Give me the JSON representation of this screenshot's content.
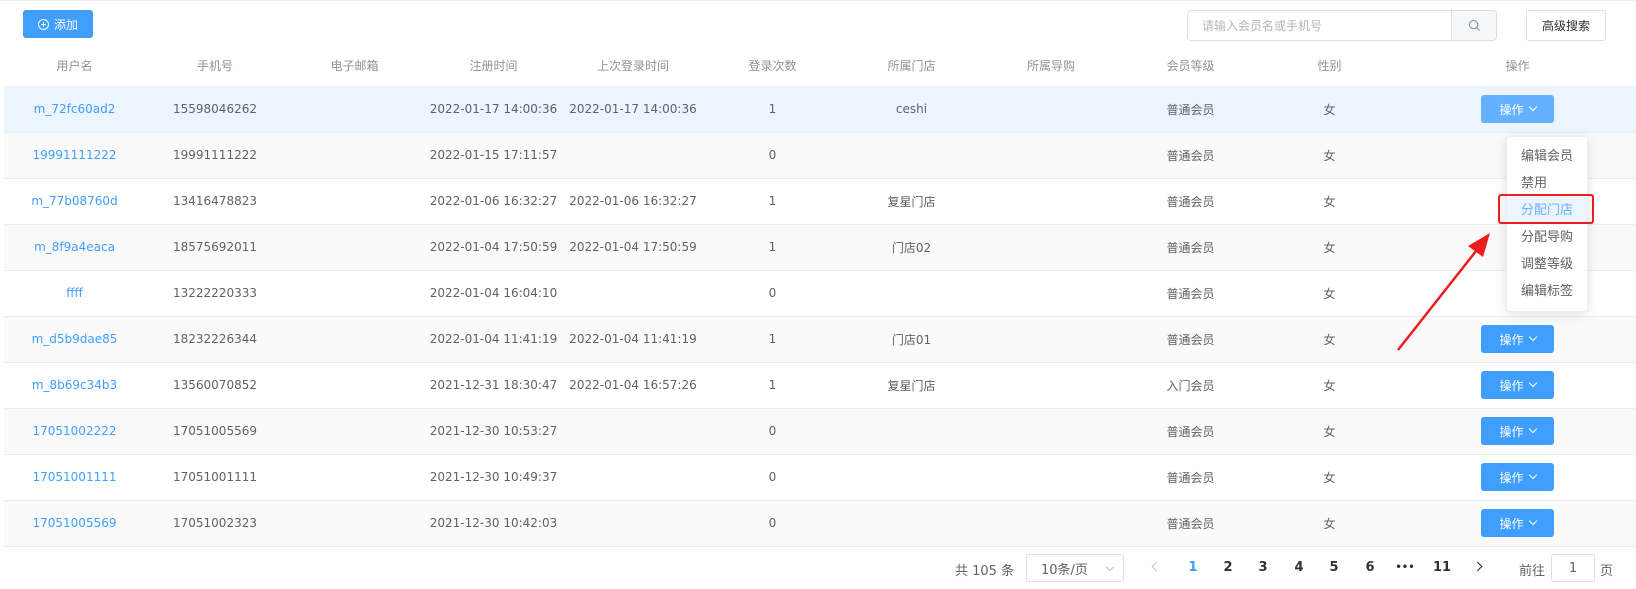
{
  "toolbar": {
    "add_label": "添加",
    "search_placeholder": "请输入会员名或手机号",
    "advanced_search_label": "高级搜索"
  },
  "table": {
    "columns": [
      "用户名",
      "手机号",
      "电子邮箱",
      "注册时间",
      "上次登录时间",
      "登录次数",
      "所属门店",
      "所属导购",
      "会员等级",
      "性别",
      "操作"
    ],
    "rows": [
      {
        "user": "m_72fc60ad2",
        "phone": "15598046262",
        "email": "",
        "reg": "2022-01-17 14:00:36",
        "last": "2022-01-17 14:00:36",
        "count": "1",
        "store": "ceshi",
        "guide": "",
        "level": "普通会员",
        "gender": "女"
      },
      {
        "user": "19991111222",
        "phone": "19991111222",
        "email": "",
        "reg": "2022-01-15 17:11:57",
        "last": "",
        "count": "0",
        "store": "",
        "guide": "",
        "level": "普通会员",
        "gender": "女"
      },
      {
        "user": "m_77b08760d",
        "phone": "13416478823",
        "email": "",
        "reg": "2022-01-06 16:32:27",
        "last": "2022-01-06 16:32:27",
        "count": "1",
        "store": "复星门店",
        "guide": "",
        "level": "普通会员",
        "gender": "女"
      },
      {
        "user": "m_8f9a4eaca",
        "phone": "18575692011",
        "email": "",
        "reg": "2022-01-04 17:50:59",
        "last": "2022-01-04 17:50:59",
        "count": "1",
        "store": "门店02",
        "guide": "",
        "level": "普通会员",
        "gender": "女"
      },
      {
        "user": "ffff",
        "phone": "13222220333",
        "email": "",
        "reg": "2022-01-04 16:04:10",
        "last": "",
        "count": "0",
        "store": "",
        "guide": "",
        "level": "普通会员",
        "gender": "女"
      },
      {
        "user": "m_d5b9dae85",
        "phone": "18232226344",
        "email": "",
        "reg": "2022-01-04 11:41:19",
        "last": "2022-01-04 11:41:19",
        "count": "1",
        "store": "门店01",
        "guide": "",
        "level": "普通会员",
        "gender": "女"
      },
      {
        "user": "m_8b69c34b3",
        "phone": "13560070852",
        "email": "",
        "reg": "2021-12-31 18:30:47",
        "last": "2022-01-04 16:57:26",
        "count": "1",
        "store": "复星门店",
        "guide": "",
        "level": "入门会员",
        "gender": "女"
      },
      {
        "user": "17051002222",
        "phone": "17051005569",
        "email": "",
        "reg": "2021-12-30 10:53:27",
        "last": "",
        "count": "0",
        "store": "",
        "guide": "",
        "level": "普通会员",
        "gender": "女"
      },
      {
        "user": "17051001111",
        "phone": "17051001111",
        "email": "",
        "reg": "2021-12-30 10:49:37",
        "last": "",
        "count": "0",
        "store": "",
        "guide": "",
        "level": "普通会员",
        "gender": "女"
      },
      {
        "user": "17051005569",
        "phone": "17051002323",
        "email": "",
        "reg": "2021-12-30 10:42:03",
        "last": "",
        "count": "0",
        "store": "",
        "guide": "",
        "level": "普通会员",
        "gender": "女"
      }
    ],
    "action_label": "操作"
  },
  "dropdown": {
    "items": [
      "编辑会员",
      "禁用",
      "分配门店",
      "分配导购",
      "调整等级",
      "编辑标签"
    ],
    "highlighted_index": 2
  },
  "pagination": {
    "total_text": "共 105 条",
    "page_size": "10条/页",
    "pages": [
      "1",
      "2",
      "3",
      "4",
      "5",
      "6",
      "11"
    ],
    "ellipsis": "•••",
    "current_page": "1",
    "goto_label": "前往",
    "goto_value": "1",
    "goto_suffix": "页"
  },
  "colors": {
    "primary": "#409eff",
    "annotation": "#ee1d1d"
  }
}
